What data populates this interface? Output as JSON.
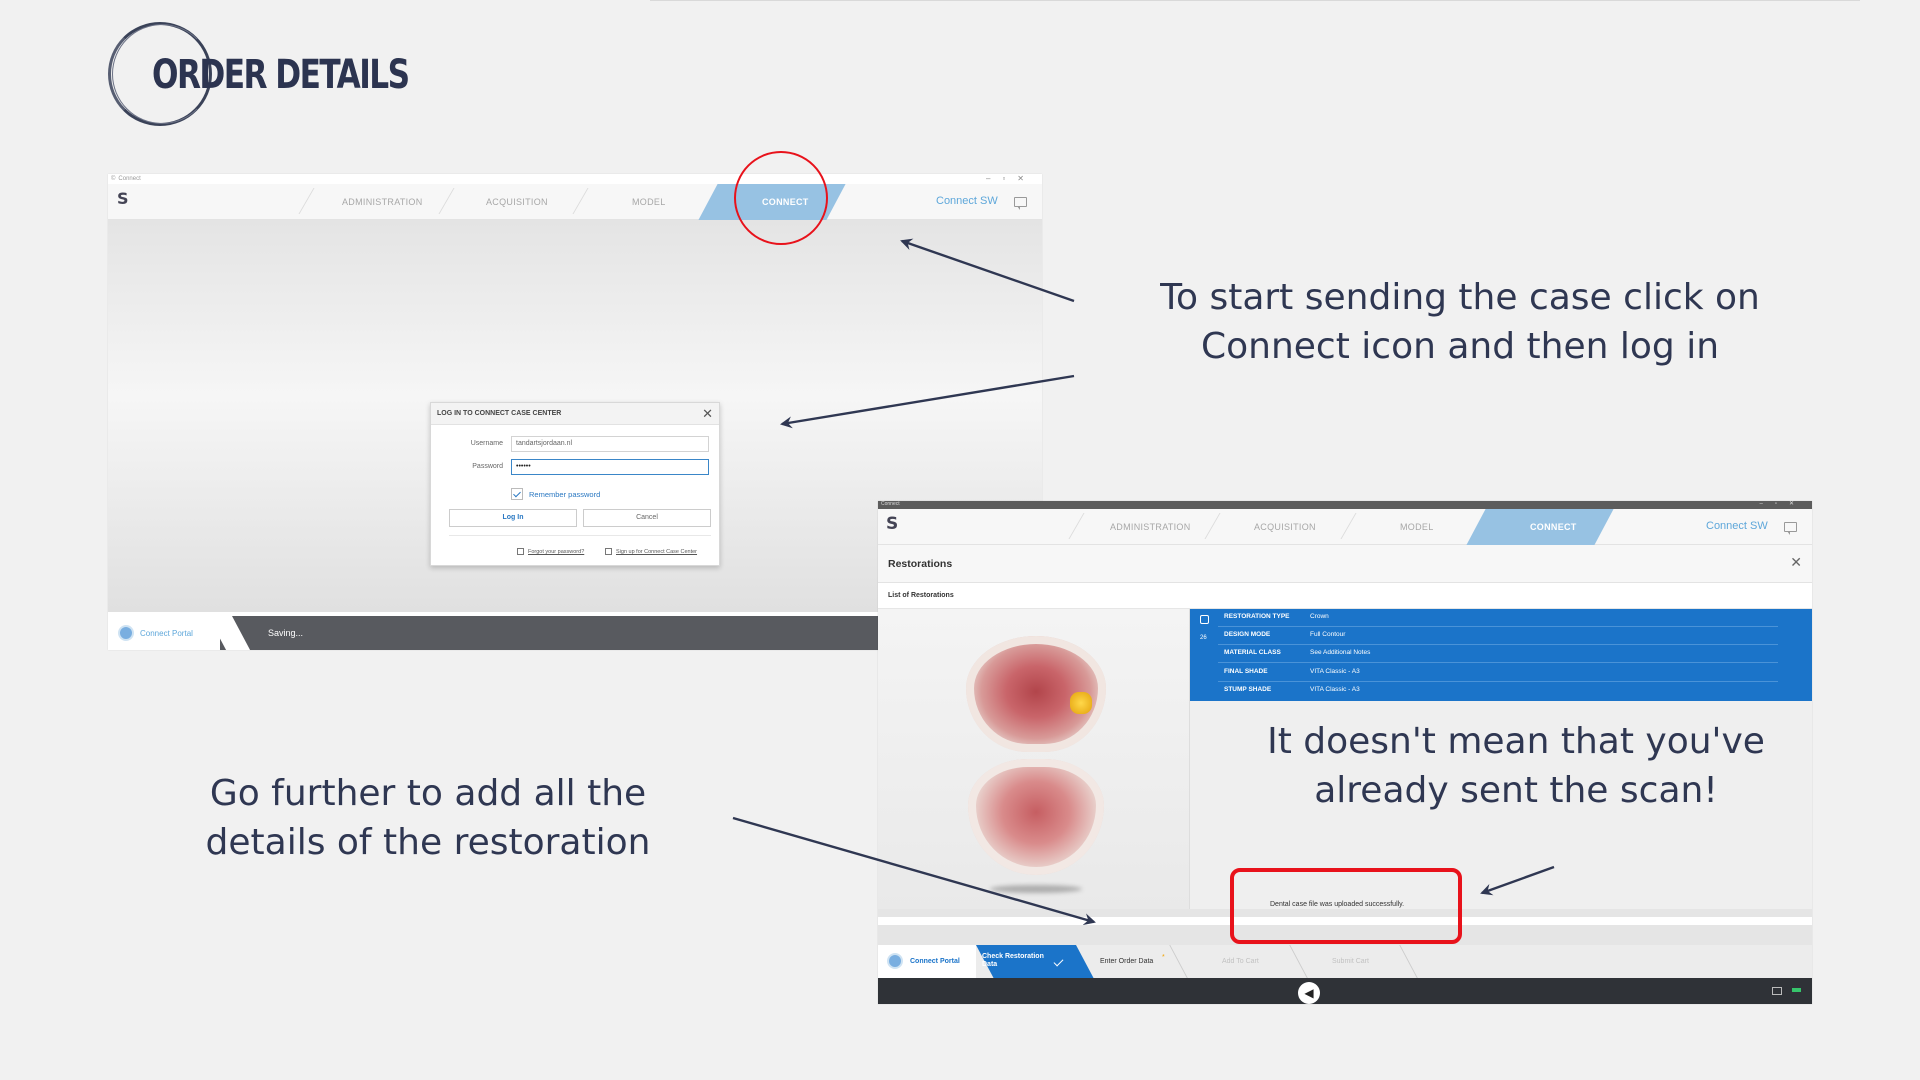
{
  "slide": {
    "title": "ORDER DETAILS",
    "caption_top": "To start sending the case click on Connect icon and then log in",
    "caption_bottom_left": "Go further to add all the details of the restoration",
    "caption_right": "It doesn't mean that you've already sent the scan!",
    "annotation_color": "#e8121b",
    "text_color": "#2f3752"
  },
  "app1": {
    "window_title": "Connect",
    "logo": "S",
    "nav": {
      "administration": "ADMINISTRATION",
      "acquisition": "ACQUISITION",
      "model": "MODEL",
      "connect": "CONNECT",
      "connect_sw": "Connect SW"
    },
    "dialog": {
      "title": "LOG IN TO CONNECT CASE CENTER",
      "username_label": "Username",
      "username_value": "tandartsjordaan.nl",
      "password_label": "Password",
      "password_value": "••••••",
      "remember_label": "Remember password",
      "remember_checked": true,
      "login_button": "Log In",
      "cancel_button": "Cancel",
      "forgot_link": "Forgot your password?",
      "signup_link": "Sign up for Connect Case Center"
    },
    "footer": {
      "portal_label": "Connect Portal",
      "status": "Saving..."
    }
  },
  "app2": {
    "window_title": "Connect",
    "logo": "S",
    "nav": {
      "administration": "ADMINISTRATION",
      "acquisition": "ACQUISITION",
      "model": "MODEL",
      "connect": "CONNECT",
      "connect_sw": "Connect SW"
    },
    "panel_title": "Restorations",
    "list_title": "List of Restorations",
    "tooth_number": "26",
    "properties": [
      {
        "key": "RESTORATION TYPE",
        "value": "Crown"
      },
      {
        "key": "DESIGN MODE",
        "value": "Full Contour"
      },
      {
        "key": "MATERIAL CLASS",
        "value": "See Additional Notes"
      },
      {
        "key": "FINAL SHADE",
        "value": "VITA Classic - A3"
      },
      {
        "key": "STUMP SHADE",
        "value": "VITA Classic - A3"
      }
    ],
    "upload_message": "Dental case file was uploaded successfully.",
    "steps": {
      "portal": "Connect Portal",
      "check": "Check Restoration Data",
      "enter": "Enter Order Data",
      "cart": "Add To Cart",
      "submit": "Submit Cart"
    },
    "accent": "#1b74c9"
  }
}
